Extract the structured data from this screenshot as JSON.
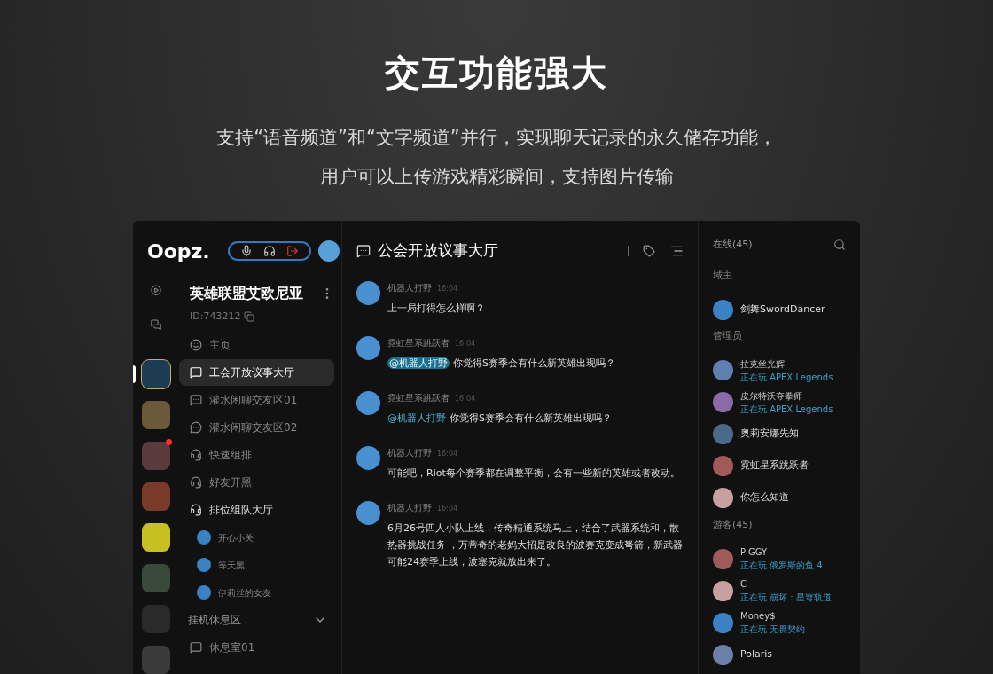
{
  "hero": {
    "title": "交互功能强大",
    "lines": [
      "支持“语音频道”和“文字频道”并行，实现聊天记录的永久储存功能，",
      "用户可以上传游戏精彩瞬间，支持图片传输"
    ]
  },
  "app": {
    "logo": "Oopz.",
    "voice_controls": {
      "mic_on": true,
      "headphones_on": true
    },
    "servers": [
      {
        "selected": true,
        "badge": false
      },
      {
        "selected": false,
        "badge": false
      },
      {
        "selected": false,
        "badge": true
      },
      {
        "selected": false,
        "badge": false
      },
      {
        "selected": false,
        "badge": false
      },
      {
        "selected": false,
        "badge": false
      },
      {
        "selected": false,
        "badge": false
      },
      {
        "selected": false,
        "badge": false
      }
    ],
    "guild": {
      "name": "英雄联盟艾欧尼亚",
      "id": "ID:743212"
    },
    "channels": [
      {
        "kind": "home",
        "name": "主页",
        "selected": false
      },
      {
        "kind": "text",
        "name": "工会开放议事大厅",
        "selected": true
      },
      {
        "kind": "text",
        "name": "灌水闲聊交友区01",
        "selected": false
      },
      {
        "kind": "text-voice",
        "name": "灌水闲聊交友区02",
        "selected": false
      },
      {
        "kind": "voice",
        "name": "快速组排",
        "selected": false
      },
      {
        "kind": "voice-lock",
        "name": "好友开黑",
        "selected": false
      },
      {
        "kind": "voice",
        "name": "排位组队大厅",
        "selected": false,
        "children": [
          {
            "name": "开心小关"
          },
          {
            "name": "等天黑"
          },
          {
            "name": "伊莉丝的女友"
          }
        ]
      },
      {
        "kind": "category",
        "name": "挂机休息区",
        "expanded": true
      },
      {
        "kind": "text",
        "name": "休息室01",
        "selected": false
      }
    ],
    "chat": {
      "title": "公会开放议事大厅",
      "messages": [
        {
          "author": "机器人打野",
          "time": "16:04",
          "text": "上一局打得怎么样啊？"
        },
        {
          "author": "霓虹星系跳跃者",
          "time": "16:04",
          "mention": "@机器人打野",
          "mention_highlighted": true,
          "text": "你觉得S赛季会有什么新英雄出现吗？"
        },
        {
          "author": "霓虹星系跳跃者",
          "time": "16:04",
          "mention": "@机器人打野",
          "mention_highlighted": false,
          "text": "你觉得S赛季会有什么新英雄出现吗？"
        },
        {
          "author": "机器人打野",
          "time": "16:04",
          "text": "可能吧，Riot每个赛季都在调整平衡，会有一些新的英雄或者改动。"
        },
        {
          "author": "机器人打野",
          "time": "16:04",
          "text": "6月26号四人小队上线，传奇精通系统马上，结合了武器系统和，散热器挑战任务 ，万蒂奇的老妈大招是改良的波赛克变成弩箭，新武器可能24赛季上线，波塞克就放出来了。"
        }
      ]
    },
    "members": {
      "title": "在线(45)",
      "groups": [
        {
          "title": "域主",
          "members": [
            {
              "name": "剑舞SwordDancer"
            }
          ]
        },
        {
          "title": "管理员",
          "members": [
            {
              "name": "拉克丝光辉",
              "status": "正在玩 APEX Legends"
            },
            {
              "name": "皮尔特沃夺拳师",
              "status": "正在玩 APEX Legends"
            },
            {
              "name": "奥莉安娜先知"
            },
            {
              "name": "霓虹星系跳跃者"
            },
            {
              "name": "你怎么知道"
            }
          ]
        },
        {
          "title": "游客(45)",
          "members": [
            {
              "name": "PIGGY",
              "status": "正在玩 俄罗斯的鱼 4"
            },
            {
              "name": "C",
              "status": "正在玩 崩坏：星穹轨道"
            },
            {
              "name": "Money$",
              "status": "正在玩 无畏契约"
            },
            {
              "name": "Polaris"
            }
          ]
        }
      ]
    }
  }
}
